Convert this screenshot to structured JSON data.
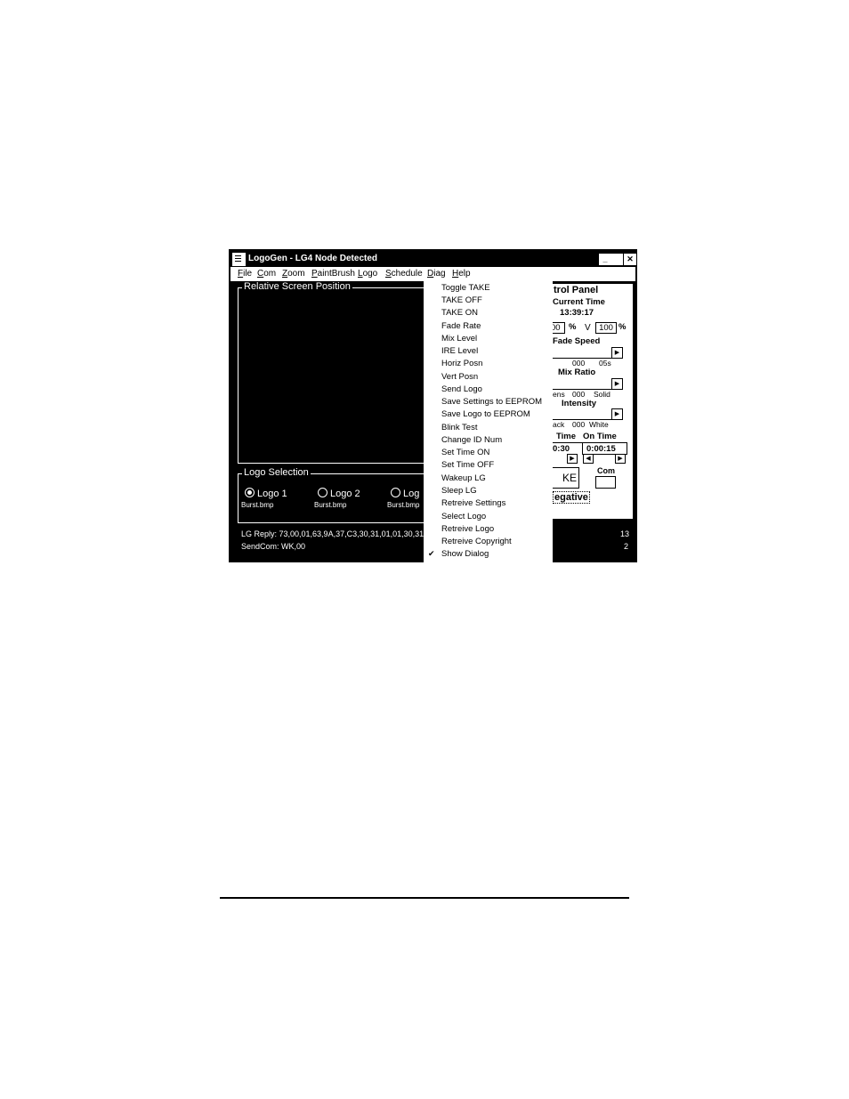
{
  "window": {
    "title": "LogoGen - LG4 Node Detected",
    "minimize_glyph": "_",
    "maximize_glyph": "",
    "close_glyph": "✕"
  },
  "menubar": [
    "File",
    "Com",
    "Zoom",
    "PaintBrush",
    "Logo",
    "Schedule",
    "Diag",
    "Help"
  ],
  "position_group": {
    "label": "Relative Screen Position"
  },
  "logo_selection": {
    "label": "Logo Selection",
    "options": [
      {
        "label": "Logo 1",
        "file": "Burst.bmp",
        "selected": true
      },
      {
        "label": "Logo 2",
        "file": "Burst.bmp",
        "selected": false
      },
      {
        "label": "Log",
        "file": "Burst.bmp",
        "selected": false
      }
    ]
  },
  "status": {
    "reply": "LG Reply: 73,00,01,63,9A,37,C3,30,31,01,01,30,31",
    "sendcom": "SendCom: WK,00",
    "right_top": "13",
    "right_bottom": "2"
  },
  "control_panel": {
    "title": "trol Panel",
    "current_time_label": "Current Time",
    "current_time": "13:39:17",
    "h_value": "00",
    "h_unit": "%",
    "v_label": "V",
    "v_value": "100",
    "v_unit": "%",
    "fade_speed_label": "Fade Speed",
    "fade_min": "000",
    "fade_max": "05s",
    "mix_ratio_label": "Mix Ratio",
    "mix_left": "ens",
    "mix_value": "000",
    "mix_right": "Solid",
    "intensity_label": "Intensity",
    "intensity_left": "ack",
    "intensity_value": "000",
    "intensity_right": "White",
    "off_time_label": "Time",
    "on_time_label": "On Time",
    "off_time_value": "0:30",
    "on_time_value": "0:00:15",
    "take_label": "KE",
    "com_label": "Com",
    "negative_label": "egative"
  },
  "diag_menu": {
    "items": [
      "Toggle TAKE",
      "TAKE OFF",
      "TAKE ON",
      "Fade Rate",
      "Mix Level",
      "IRE Level",
      "Horiz Posn",
      "Vert Posn",
      "Send Logo",
      "Save Settings to EEPROM",
      "Save Logo to EEPROM",
      "Blink Test",
      "Change ID Num",
      "Set Time ON",
      "Set Time OFF",
      "Wakeup LG",
      "Sleep LG",
      "Retreive Settings",
      "Select Logo",
      "Retreive Logo",
      "Retreive Copyright",
      "Show Dialog"
    ],
    "checked_item": "Show Dialog",
    "check_glyph": "✔"
  }
}
